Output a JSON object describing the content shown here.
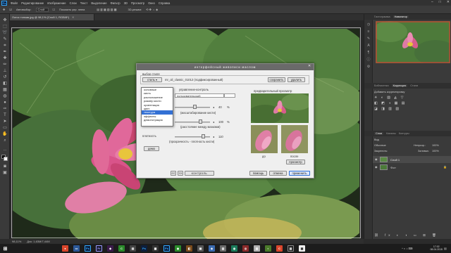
{
  "menubar": {
    "logo": "Ps",
    "items": [
      "Файл",
      "Редактирование",
      "Изображение",
      "Слои",
      "Текст",
      "Выделение",
      "Фильтр",
      "3D",
      "Просмотр",
      "Окно",
      "Справка"
    ]
  },
  "optbar": {
    "items": [
      "Автовыбор:",
      "Слой",
      "Показать упр. элем."
    ],
    "mode_label": "3D-режим:"
  },
  "document": {
    "tab": "Лотос тонкая.jpg @ 98,1% (Слой 1, RGB/8*)",
    "zoom": "98,11%",
    "doc_info": "Док: 1,63M/7,44M"
  },
  "dialog": {
    "title": "интерфейсный живописи маслом",
    "style_group": "выбор стиля",
    "style_button": "стиль ▾",
    "style_name": "mr_oil_classic_01012 (подфиксированный)",
    "save": "сохранить",
    "delete": "удалить",
    "control_header": "управление-контроль",
    "preset_field": "пользовательский",
    "val1": "40",
    "unit1": "%",
    "hint1": "(масштабирование кисти)",
    "val2": "100",
    "unit2": "%",
    "hint2": "(расстояние между мазками)",
    "density_label": "плотность",
    "val3": "110",
    "hint3": "(прозрачность - плотность кисти)",
    "demo": "демо",
    "preview_label": "предварительный просмотр",
    "before": "до",
    "after": "после",
    "preview_button": "просмотр",
    "nav_prev": "<<",
    "nav_next": ">>",
    "control_button": "контроль",
    "help": "помощь",
    "cancel": "отмена",
    "apply": "применить",
    "dropdown_current": "основные"
  },
  "dropdown": {
    "options": [
      "основные",
      "кисть",
      "расположение",
      "размер кисти",
      "ориентация",
      "цвет",
      "текстура",
      "эффекты",
      "демонстрация"
    ],
    "selected_index": 6
  },
  "panels": {
    "top_tabs": [
      "Гистограмма",
      "Навигатор"
    ],
    "mid_tabs": [
      "Библиотеки",
      "Коррекция",
      "Стили"
    ],
    "add_correction": "Добавить корректировку",
    "layers_tabs": [
      "Слои",
      "Каналы",
      "Контуры"
    ],
    "kind": "Вид",
    "blend_mode": "Обычные",
    "opacity_label": "Непрозр.:",
    "opacity": "100%",
    "lock_label": "Закрепить:",
    "fill_label": "Заливка:",
    "fill": "100%",
    "layers": [
      "Слой 1",
      "Фон"
    ]
  },
  "taskbar": {
    "time": "17:02",
    "date": "08.04.2015"
  },
  "colors": {
    "accent": "#3370d4",
    "ps_blue": "#31a8ff"
  }
}
